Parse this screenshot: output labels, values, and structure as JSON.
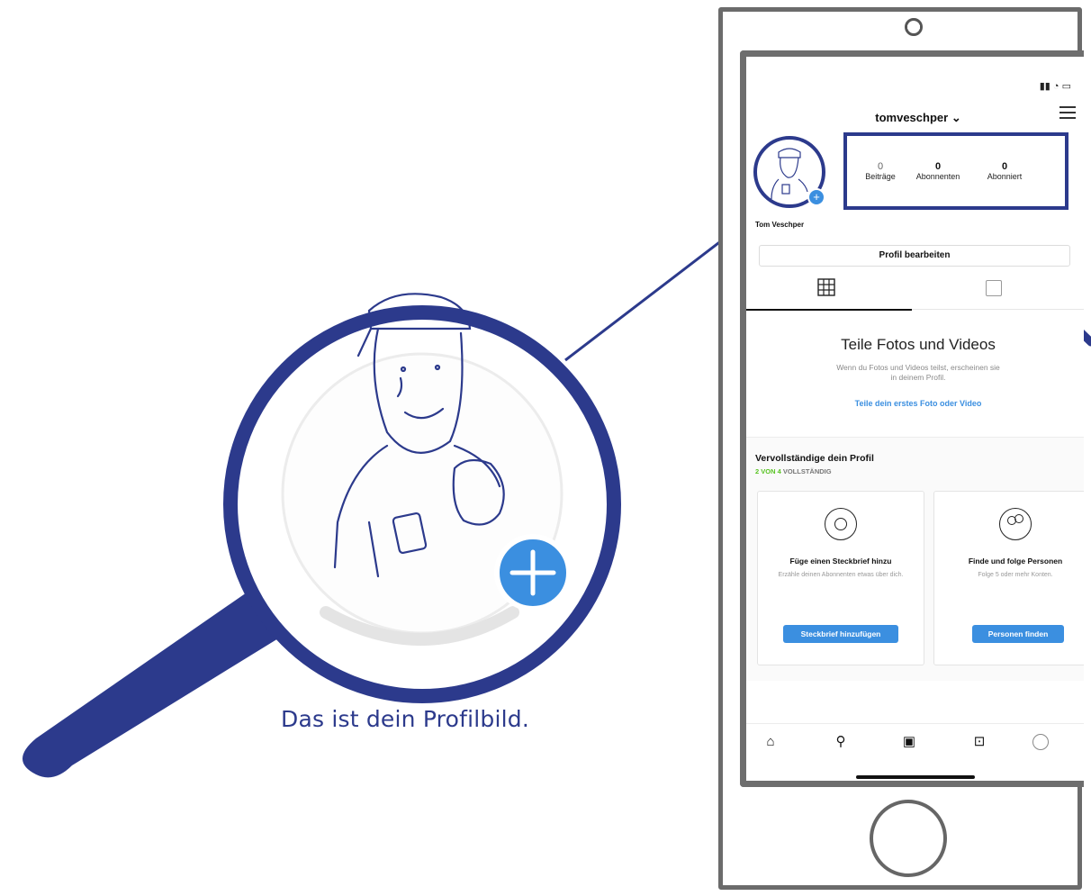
{
  "caption": "Das ist dein Profilbild.",
  "colors": {
    "annotation": "#2c3a8c",
    "accent": "#3b8fe0",
    "progress": "#58c322"
  },
  "profile": {
    "username": "tomveschper",
    "name": "Tom Veschper",
    "edit_button": "Profil bearbeiten",
    "stats": [
      {
        "value": "0",
        "label": "Beiträge"
      },
      {
        "value": "0",
        "label": "Abonnenten"
      },
      {
        "value": "0",
        "label": "Abonniert"
      }
    ]
  },
  "empty_state": {
    "title": "Teile Fotos und Videos",
    "text": "Wenn du Fotos und Videos teilst, erscheinen sie in deinem Profil.",
    "link": "Teile dein erstes Foto oder Video"
  },
  "complete_profile": {
    "title": "Vervollständige dein Profil",
    "progress_highlight": "2 VON 4",
    "progress_rest": " VOLLSTÄNDIG",
    "cards": [
      {
        "icon": "speech-bubble-icon",
        "title": "Füge einen Steckbrief hinzu",
        "text": "Erzähle deinen Abonnenten etwas über dich.",
        "button": "Steckbrief hinzufügen"
      },
      {
        "icon": "people-icon",
        "title": "Finde und folge Personen",
        "text": "Folge 5 oder mehr Konten.",
        "button": "Personen finden"
      }
    ]
  },
  "tabbar": [
    "home-icon",
    "search-icon",
    "reels-icon",
    "shop-icon",
    "profile-avatar-icon"
  ]
}
